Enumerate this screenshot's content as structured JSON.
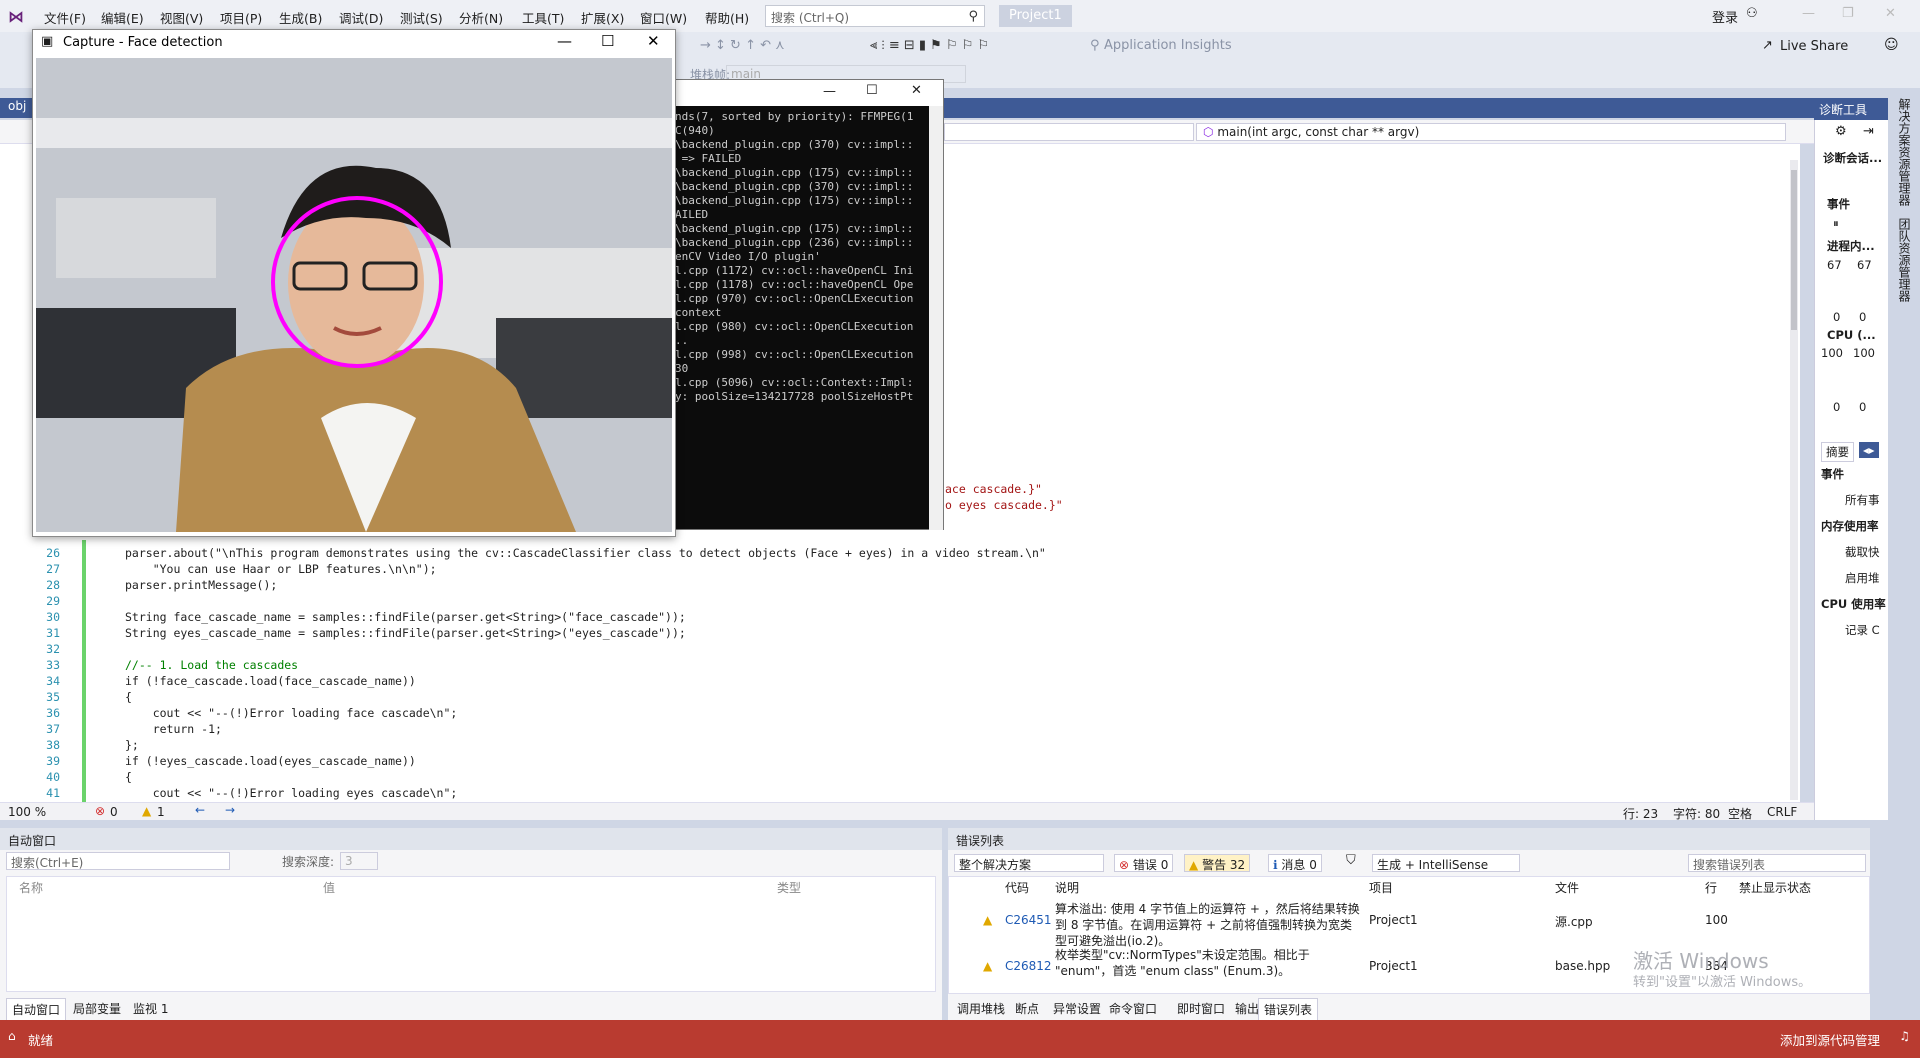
{
  "menu": [
    "文件(F)",
    "编辑(E)",
    "视图(V)",
    "项目(P)",
    "生成(B)",
    "调试(D)",
    "测试(S)",
    "分析(N)",
    "工具(T)",
    "扩展(X)",
    "窗口(W)",
    "帮助(H)"
  ],
  "search": {
    "placeholder": "搜索 (Ctrl+Q)"
  },
  "project_title": "Project1",
  "login": "登录",
  "toolbar": {
    "insights": "Application Insights",
    "live_share": "Live Share",
    "stack_frame": "堆栈帧:",
    "stack_val": "main"
  },
  "doc_tab": "obj",
  "nav": {
    "member": "main(int argc, const char ** argv)"
  },
  "capture_window": {
    "title": "Capture - Face detection"
  },
  "console_lines": [
    "nds(7, sorted by priority): FFMPEG(1",
    "C(940)",
    "\\backend_plugin.cpp (370) cv::impl::",
    " => FAILED",
    "\\backend_plugin.cpp (175) cv::impl::",
    "\\backend_plugin.cpp (370) cv::impl::",
    "\\backend_plugin.cpp (175) cv::impl::",
    "AILED",
    "\\backend_plugin.cpp (175) cv::impl::",
    "\\backend_plugin.cpp (236) cv::impl::",
    "enCV Video I/O plugin'",
    "l.cpp (1172) cv::ocl::haveOpenCL Ini",
    "l.cpp (1178) cv::ocl::haveOpenCL Ope",
    "l.cpp (970) cv::ocl::OpenCLExecution",
    "context",
    "l.cpp (980) cv::ocl::OpenCLExecution",
    "..",
    "l.cpp (998) cv::ocl::OpenCLExecution",
    "30",
    "l.cpp (5096) cv::ocl::Context::Impl:",
    "y: poolSize=134217728 poolSizeHostPt"
  ],
  "code_fragments": [
    "ace cascade.}\"",
    "o eyes cascade.}\""
  ],
  "code_lines": [
    {
      "n": "26",
      "t": "parser.about(\"\\nThis program demonstrates using the cv::CascadeClassifier class to detect objects (Face + eyes) in a video stream.\\n\""
    },
    {
      "n": "27",
      "t": "    \"You can use Haar or LBP features.\\n\\n\");"
    },
    {
      "n": "28",
      "t": "parser.printMessage();"
    },
    {
      "n": "29",
      "t": ""
    },
    {
      "n": "30",
      "t": "String face_cascade_name = samples::findFile(parser.get<String>(\"face_cascade\"));"
    },
    {
      "n": "31",
      "t": "String eyes_cascade_name = samples::findFile(parser.get<String>(\"eyes_cascade\"));"
    },
    {
      "n": "32",
      "t": ""
    },
    {
      "n": "33",
      "t": "//-- 1. Load the cascades"
    },
    {
      "n": "34",
      "t": "if (!face_cascade.load(face_cascade_name))"
    },
    {
      "n": "35",
      "t": "{"
    },
    {
      "n": "36",
      "t": "    cout << \"--(!)Error loading face cascade\\n\";"
    },
    {
      "n": "37",
      "t": "    return -1;"
    },
    {
      "n": "38",
      "t": "};"
    },
    {
      "n": "39",
      "t": "if (!eyes_cascade.load(eyes_cascade_name))"
    },
    {
      "n": "40",
      "t": "{"
    },
    {
      "n": "41",
      "t": "    cout << \"--(!)Error loading eyes cascade\\n\";"
    }
  ],
  "editor_status": {
    "zoom": "100 %",
    "errors": "0",
    "warnings": "1",
    "row": "行: 23",
    "col": "字符: 80",
    "space": "空格",
    "crlf": "CRLF"
  },
  "diag": {
    "title": "诊断工具",
    "session": "诊断会话...",
    "events": "事件",
    "process": "进程内...",
    "mem1": "67",
    "mem2": "67",
    "zero1": "0",
    "zero2": "0",
    "cpu": "CPU (...",
    "cpu1": "100",
    "cpu2": "100",
    "zero3": "0",
    "zero4": "0",
    "summary": "摘要",
    "events2": "事件",
    "allevents": "所有事",
    "memuse": "内存使用率",
    "snapshot": "截取快",
    "enable": "启用堆",
    "cpuuse": "CPU 使用率",
    "record": "记录 C"
  },
  "right_strip": [
    "解决方案资源管理器",
    "团队资源管理器"
  ],
  "auto": {
    "title": "自动窗口",
    "search": "搜索(Ctrl+E)",
    "depth_label": "搜索深度:",
    "depth": "3",
    "col_name": "名称",
    "col_value": "值",
    "col_type": "类型",
    "tabs": [
      "自动窗口",
      "局部变量",
      "监视 1"
    ]
  },
  "errors": {
    "title": "错误列表",
    "scope": "整个解决方案",
    "err_btn": "错误 0",
    "warn_btn": "警告 32",
    "msg_btn": "消息 0",
    "build": "生成 + IntelliSense",
    "search": "搜索错误列表",
    "cols": [
      "代码",
      "说明",
      "项目",
      "文件",
      "行",
      "禁止显示状态"
    ],
    "rows": [
      {
        "code": "C26451",
        "desc": "算术溢出: 使用 4 字节值上的运算符 + ，然后将结果转换到 8 字节值。在调用运算符 + 之前将值强制转换为宽类型可避免溢出(io.2)。",
        "project": "Project1",
        "file": "源.cpp",
        "line": "100"
      },
      {
        "code": "C26812",
        "desc": "枚举类型\"cv::NormTypes\"未设定范围。相比于 \"enum\"，首选 \"enum class\" (Enum.3)。",
        "project": "Project1",
        "file": "base.hpp",
        "line": "384"
      }
    ],
    "tabs": [
      "调用堆栈",
      "断点",
      "异常设置",
      "命令窗口",
      "即时窗口",
      "输出",
      "错误列表"
    ],
    "watermark1": "激活 Windows",
    "watermark2": "转到\"设置\"以激活 Windows。"
  },
  "status": {
    "ready": "就绪",
    "source": "添加到源代码管理"
  }
}
